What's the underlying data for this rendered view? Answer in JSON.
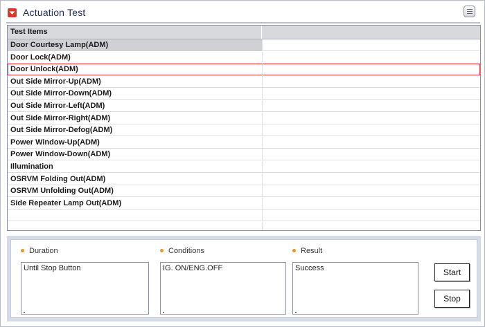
{
  "header": {
    "title": "Actuation Test"
  },
  "table": {
    "columns": [
      "Test Items",
      ""
    ],
    "rows": [
      "Door Courtesy Lamp(ADM)",
      "Door Lock(ADM)",
      "Door Unlock(ADM)",
      "Out Side Mirror-Up(ADM)",
      "Out Side Mirror-Down(ADM)",
      "Out Side Mirror-Left(ADM)",
      "Out Side Mirror-Right(ADM)",
      "Out Side Mirror-Defog(ADM)",
      "Power Window-Up(ADM)",
      "Power Window-Down(ADM)",
      "Illumination",
      "OSRVM Folding Out(ADM)",
      "OSRVM Unfolding Out(ADM)",
      "Side Repeater Lamp Out(ADM)",
      "",
      ""
    ],
    "selected_row": "Door Courtesy Lamp(ADM)",
    "focused_row": "Door Unlock(ADM)"
  },
  "details": {
    "duration": {
      "label": "Duration",
      "value": "Until Stop Button"
    },
    "conditions": {
      "label": "Conditions",
      "value": "IG. ON/ENG.OFF"
    },
    "result": {
      "label": "Result",
      "value": "Success"
    }
  },
  "buttons": {
    "start": "Start",
    "stop": "Stop"
  },
  "colors": {
    "accent": "#d83a2a",
    "focus_outline": "#e0363a",
    "bullet": "#e8942a",
    "panel_bg": "#d5dbe7"
  }
}
